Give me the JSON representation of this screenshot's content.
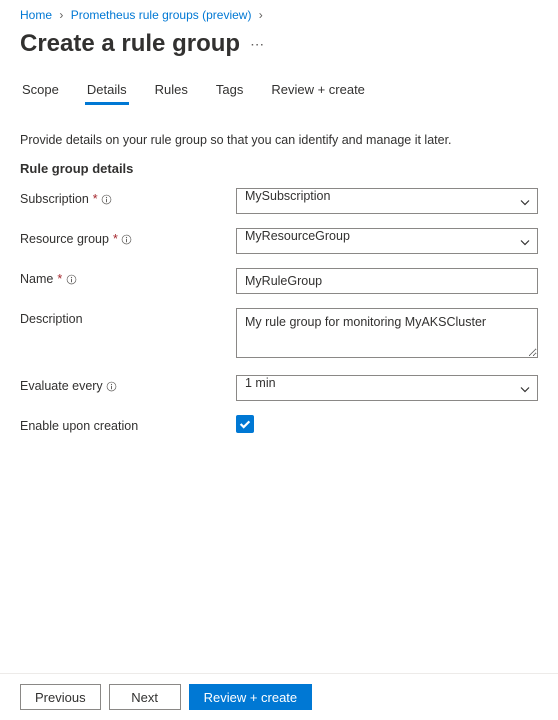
{
  "breadcrumb": {
    "home": "Home",
    "parent": "Prometheus rule groups (preview)"
  },
  "page": {
    "title": "Create a rule group"
  },
  "tabs": {
    "scope": "Scope",
    "details": "Details",
    "rules": "Rules",
    "tags": "Tags",
    "review": "Review + create"
  },
  "intro": "Provide details on your rule group so that you can identify and manage it later.",
  "section": {
    "title": "Rule group details"
  },
  "form": {
    "subscription_label": "Subscription",
    "subscription_value": "MySubscription",
    "resource_group_label": "Resource group",
    "resource_group_value": "MyResourceGroup",
    "name_label": "Name",
    "name_value": "MyRuleGroup",
    "description_label": "Description",
    "description_value": "My rule group for monitoring MyAKSCluster",
    "evaluate_label": "Evaluate every",
    "evaluate_value": "1 min",
    "enable_label": "Enable upon creation"
  },
  "footer": {
    "previous": "Previous",
    "next": "Next",
    "review": "Review + create"
  }
}
